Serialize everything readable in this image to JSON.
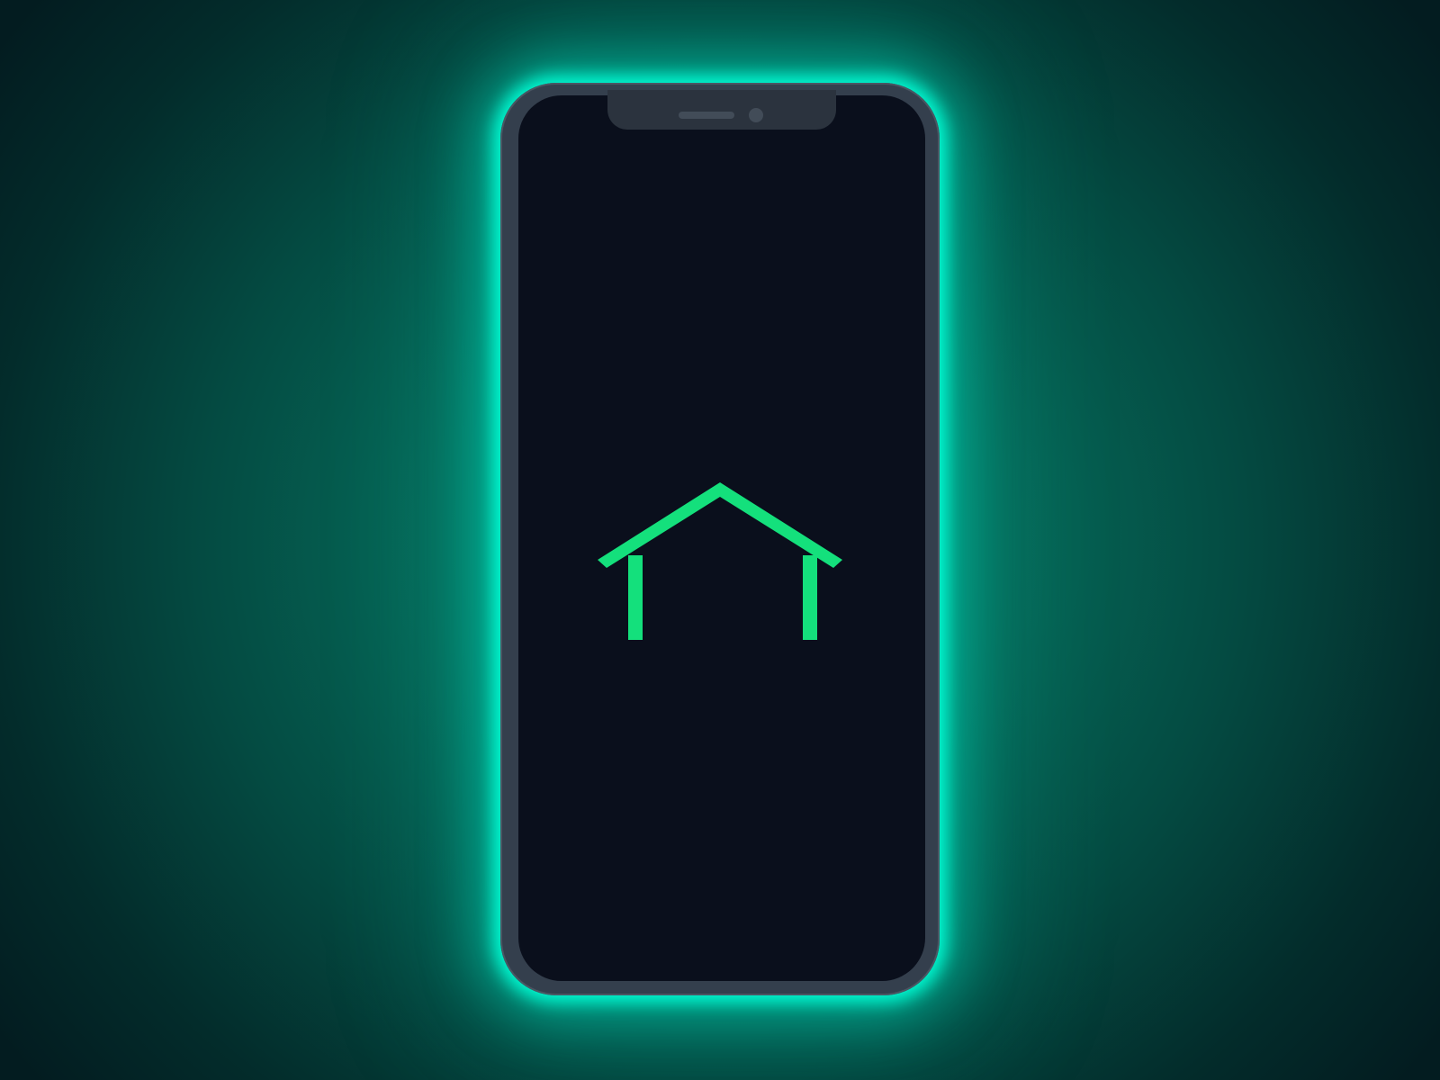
{
  "device": {
    "type": "smartphone",
    "state": "splash-screen"
  },
  "colors": {
    "glow": "#00f5d0",
    "logo": "#14e07c",
    "screen": "#0a0f1c",
    "frame": "#343f4d",
    "background_center": "#078a72",
    "background_edge": "#031c20"
  },
  "logo": {
    "icon": "home-icon"
  }
}
